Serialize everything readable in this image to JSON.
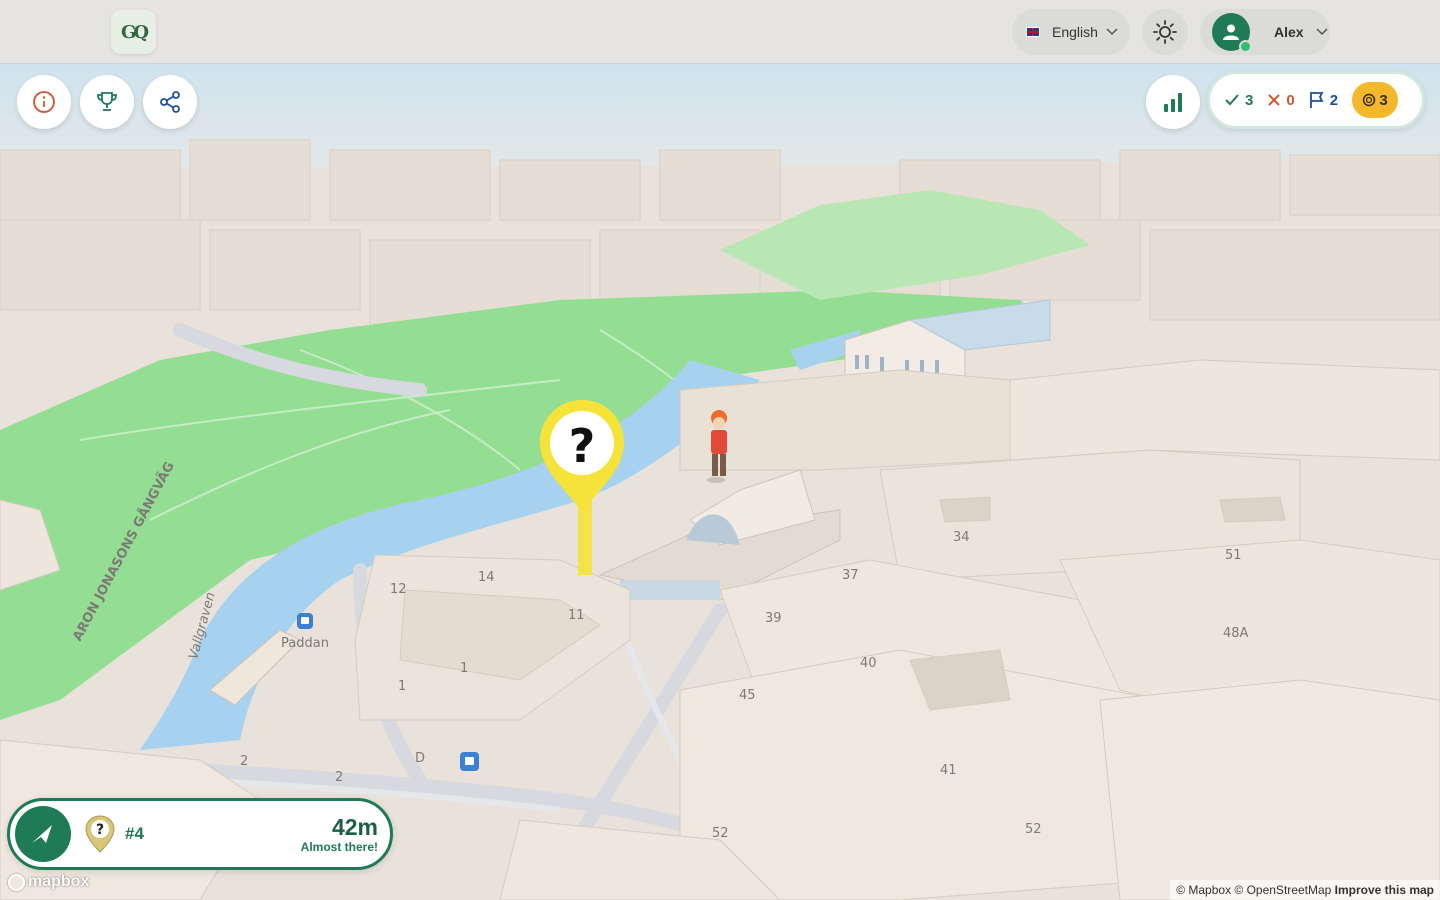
{
  "header": {
    "logo_text": "GQ",
    "language": {
      "label": "English",
      "flag_icon": "uk-flag-icon"
    },
    "theme_icon": "sun-icon",
    "user": {
      "name": "Alex",
      "avatar_icon": "user-icon",
      "online": true
    }
  },
  "toolbar": {
    "left_buttons": [
      "info-icon",
      "trophy-icon",
      "share-icon"
    ],
    "stats_icon": "bar-chart-icon"
  },
  "score": {
    "correct": "3",
    "wrong": "0",
    "flags": "2",
    "coins": "3"
  },
  "map": {
    "street_label": "ARON JONASONS GÅNGVÄG",
    "water_label": "Vallgraven",
    "poi_label": "Paddan",
    "marker_icon": "question-mark-icon",
    "labels": [
      "12",
      "14",
      "11",
      "1",
      "1",
      "2",
      "2",
      "D",
      "34",
      "37",
      "39",
      "40",
      "45",
      "41",
      "51",
      "48A",
      "52",
      "52"
    ]
  },
  "navigation": {
    "target_number": "#4",
    "distance": "42m",
    "status": "Almost there!"
  },
  "attribution": {
    "logo": "mapbox",
    "text": "© Mapbox © OpenStreetMap",
    "improve_link": "Improve this map"
  },
  "colors": {
    "brand_green": "#1f7a56",
    "wrong_red": "#d2552d",
    "flag_blue": "#1d4e9e",
    "coin_yellow": "#f3b82b",
    "marker_yellow": "#f6e339",
    "water": "#a6d2ef",
    "park": "#8fdc8f",
    "building": "#ece3da"
  }
}
